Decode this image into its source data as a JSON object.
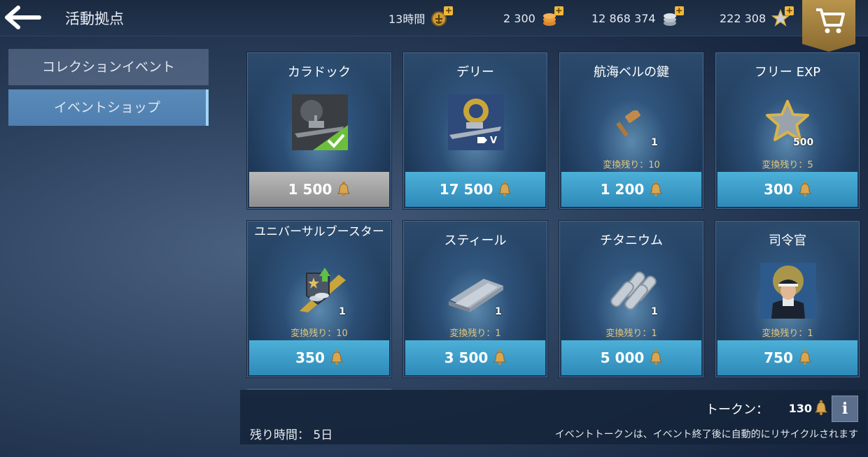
{
  "header": {
    "title": "活動拠点",
    "resources": [
      {
        "value": "13時間",
        "icon": "premium-account-icon"
      },
      {
        "value": "2 300",
        "icon": "gold-coins-icon"
      },
      {
        "value": "12 868 374",
        "icon": "silver-coins-icon"
      },
      {
        "value": "222 308",
        "icon": "free-exp-star-icon"
      }
    ]
  },
  "sidebar": {
    "items": [
      {
        "label": "コレクションイベント"
      },
      {
        "label": "イベントショップ"
      }
    ]
  },
  "cards": [
    {
      "name": "カラドック",
      "price": "1 500",
      "status": "owned",
      "badge": "check-icon"
    },
    {
      "name": "デリー",
      "price": "17 500",
      "tier": "V"
    },
    {
      "name": "航海ベルの鍵",
      "price": "1 200",
      "qty": "1",
      "remaining": "変換残り：10"
    },
    {
      "name": "フリー EXP",
      "price": "300",
      "qty": "500",
      "remaining": "変換残り：5"
    },
    {
      "name": "ユニバーサルブースター",
      "price": "350",
      "qty": "1",
      "remaining": "変換残り：10"
    },
    {
      "name": "スティール",
      "price": "3 500",
      "qty": "1",
      "remaining": "変換残り：1"
    },
    {
      "name": "チタニウム",
      "price": "5 000",
      "qty": "1",
      "remaining": "変換残り：1"
    },
    {
      "name": "司令官",
      "price": "750",
      "remaining": "変換残り：1"
    }
  ],
  "footer": {
    "tokens_label": "トークン：",
    "tokens_value": "130",
    "info_label": "i",
    "time_left": "残り時間： 5日",
    "recycle_note": "イベントトークンは、イベント終了後に自動的にリサイクルされます"
  },
  "colors": {
    "accent": "#4cb0d8",
    "gold": "#f0b83a",
    "remaining_text": "#e3c77a",
    "cart": "#b8944c"
  }
}
